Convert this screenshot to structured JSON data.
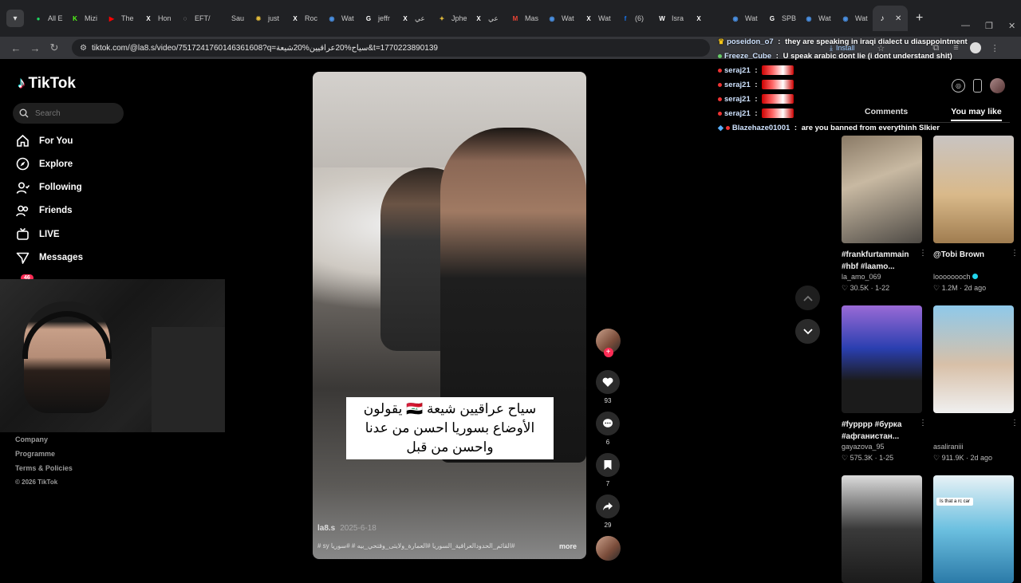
{
  "browser": {
    "tabs": [
      {
        "label": "All E",
        "icon": "spotify-icon",
        "color": "#1ed760"
      },
      {
        "label": "Mizi",
        "icon": "k-icon",
        "color": "#53fc18"
      },
      {
        "label": "The",
        "icon": "youtube-icon",
        "color": "#ff0000"
      },
      {
        "label": "Hon",
        "icon": "x-icon",
        "color": "#ffffff"
      },
      {
        "label": "EFT/",
        "icon": "globe-icon",
        "color": "#cccccc"
      },
      {
        "label": "Sau",
        "icon": "blank-icon",
        "color": "#555555"
      },
      {
        "label": "just",
        "icon": "cog-icon",
        "color": "#e0b93a"
      },
      {
        "label": "Roc",
        "icon": "x-icon",
        "color": "#ffffff"
      },
      {
        "label": "Wat",
        "icon": "watch-icon",
        "color": "#4a90e2"
      },
      {
        "label": "jeffr",
        "icon": "google-icon",
        "color": "#ffffff"
      },
      {
        "label": "عي",
        "icon": "x-icon",
        "color": "#ffffff"
      },
      {
        "label": "Jphe",
        "icon": "bolt-icon",
        "color": "#e0b93a"
      },
      {
        "label": "عي",
        "icon": "x-icon",
        "color": "#ffffff"
      },
      {
        "label": "Mas",
        "icon": "gmail-icon",
        "color": "#ea4335"
      },
      {
        "label": "Wat",
        "icon": "watch-icon",
        "color": "#4a90e2"
      },
      {
        "label": "Wat",
        "icon": "x-icon",
        "color": "#ffffff"
      },
      {
        "label": "(6)",
        "icon": "facebook-icon",
        "color": "#1877f2"
      },
      {
        "label": "Isra",
        "icon": "wikipedia-icon",
        "color": "#ffffff"
      },
      {
        "label": "",
        "icon": "x-icon",
        "color": "#ffffff"
      },
      {
        "label": "Wat",
        "icon": "watch-icon",
        "color": "#4a90e2"
      },
      {
        "label": "SPB",
        "icon": "google-icon",
        "color": "#ffffff"
      },
      {
        "label": "Wat",
        "icon": "watch-icon",
        "color": "#4a90e2"
      },
      {
        "label": "Wat",
        "icon": "watch-icon",
        "color": "#4a90e2"
      }
    ],
    "active_tab_icon": "tiktok-icon",
    "new_tab": "+",
    "url": "tiktok.com/@la8.s/video/7517241760146361608?q=سياح%20عراقيين%20شيعة&t=1770223890139",
    "install_label": "Install"
  },
  "sidebar": {
    "logo_text": "TikTok",
    "search_placeholder": "Search",
    "nav": [
      {
        "label": "For You",
        "icon": "home-icon"
      },
      {
        "label": "Explore",
        "icon": "compass-icon"
      },
      {
        "label": "Following",
        "icon": "following-icon"
      },
      {
        "label": "Friends",
        "icon": "friends-icon"
      },
      {
        "label": "LIVE",
        "icon": "live-icon"
      },
      {
        "label": "Messages",
        "icon": "messages-icon"
      }
    ],
    "activity_badge": "46",
    "footer": [
      "Company",
      "Programme",
      "Terms & Policies",
      "© 2026 TikTok"
    ]
  },
  "video": {
    "caption": "سياح عراقيين شيعة 🇮🇶 يقولون الأوضاع بسوريا احسن من عدنا واحسن من قبل",
    "author": "la8.s",
    "date": "2025-6-18",
    "tags": "#القائم_الحدودالعراقية_السوريا #العمارة_ولايتى_وقتحي_بيه # #سوريا sy #",
    "more_label": "more"
  },
  "actions": {
    "likes": "93",
    "comments": "6",
    "saves": "7",
    "shares": "29"
  },
  "chat": [
    {
      "user": "poseidon_o7",
      "text": "they are speaking in iraqi dialect u diasppointment",
      "badge": "crown"
    },
    {
      "user": "Freeze_Cube",
      "text": "U speak arabic dont lie (i dont understand shit)",
      "badge": "none"
    },
    {
      "user": "seraj21",
      "text": "",
      "badge": "dot"
    },
    {
      "user": "seraj21",
      "text": "",
      "badge": "dot"
    },
    {
      "user": "seraj21",
      "text": "",
      "badge": "dot"
    },
    {
      "user": "seraj21",
      "text": "",
      "badge": "dot"
    },
    {
      "user": "Blazehaze01001",
      "text": "are you banned from everythinh Slkier",
      "badge": "cube"
    }
  ],
  "right_panel": {
    "tab_comments": "Comments",
    "tab_you_may_like": "You may like",
    "cards": [
      {
        "title": "#frankfurtammain #hbf #laamo...",
        "author": "la_amo_069",
        "likes": "30.5K",
        "date": "1-22",
        "verified": false,
        "bg": "linear-gradient(160deg,#8a7a66,#c8b9a2 40%,#4e4a45)"
      },
      {
        "title": "@Tobi Brown",
        "author": "loooooooch",
        "likes": "1.2M",
        "date": "2d ago",
        "verified": true,
        "bg": "linear-gradient(180deg,#c9c4c2,#d9b98a 55%,#a07d50)"
      },
      {
        "title": "#fypppp #бурка #афганистан...",
        "author": "gayazova_95",
        "likes": "575.3K",
        "date": "1-25",
        "verified": false,
        "bg": "linear-gradient(180deg,#9a6ad6,#2a3fb0 40%,#1b1b1b 70%)"
      },
      {
        "title": "",
        "author": "asaliraniii",
        "likes": "911.9K",
        "date": "2d ago",
        "verified": false,
        "bg": "linear-gradient(180deg,#8ec9ea,#d8c0a8 55%,#f0f0f0)"
      },
      {
        "title": "",
        "author": "",
        "likes": "",
        "date": "",
        "verified": false,
        "bg": "linear-gradient(180deg,#dcdcdc,#3a3a3a 50%,#1b1b1b)"
      },
      {
        "title": "",
        "author": "",
        "likes": "",
        "date": "",
        "verified": false,
        "bg": "linear-gradient(180deg,#e8f2f6,#6cc0e0 50%,#2b7aa8)"
      }
    ],
    "card5_overlay": "Is that a rc car"
  },
  "colors": {
    "tiktok_red": "#fe2c55",
    "tiktok_cyan": "#25f4ee",
    "panel_bg": "#000000",
    "tabbar_bg": "#202124"
  }
}
